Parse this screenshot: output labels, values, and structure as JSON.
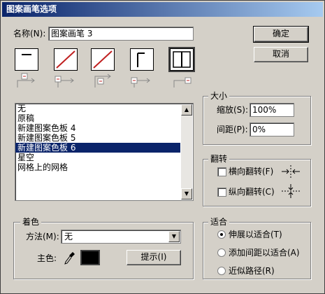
{
  "window": {
    "title": "图案画笔选项"
  },
  "name_field": {
    "label": "名称(N):",
    "value": "图案画笔 3"
  },
  "buttons": {
    "ok": "确定",
    "cancel": "取消",
    "tips": "提示(I)"
  },
  "tiles": [
    {
      "name": "side-tile",
      "selected": false
    },
    {
      "name": "outer-corner-tile",
      "selected": false
    },
    {
      "name": "inner-corner-tile",
      "selected": false
    },
    {
      "name": "start-tile",
      "selected": false
    },
    {
      "name": "end-tile",
      "selected": true
    }
  ],
  "pattern_list": {
    "items": [
      "无",
      "原稿",
      "新建图案色板 4",
      "新建图案色板 5",
      "新建图案色板 6",
      "星空",
      "网格上的网格"
    ],
    "selected_index": 4
  },
  "size_group": {
    "title": "大小",
    "scale_label": "缩放(S):",
    "scale_value": "100%",
    "spacing_label": "间距(P):",
    "spacing_value": "0%"
  },
  "flip_group": {
    "title": "翻转",
    "horizontal_label": "横向翻转(F)",
    "horizontal_checked": false,
    "vertical_label": "纵向翻转(C)",
    "vertical_checked": false
  },
  "colorization_group": {
    "title": "着色",
    "method_label": "方法(M):",
    "method_value": "无",
    "key_color_label": "主色:",
    "key_color": "#000000"
  },
  "fit_group": {
    "title": "适合",
    "options": [
      "伸展以适合(T)",
      "添加间距以适合(A)",
      "近似路径(R)"
    ],
    "selected_index": 0
  },
  "colors": {
    "accent": "#0a246a",
    "tile_slash": "#c02020",
    "dialog_bg": "#d4d0c8"
  }
}
